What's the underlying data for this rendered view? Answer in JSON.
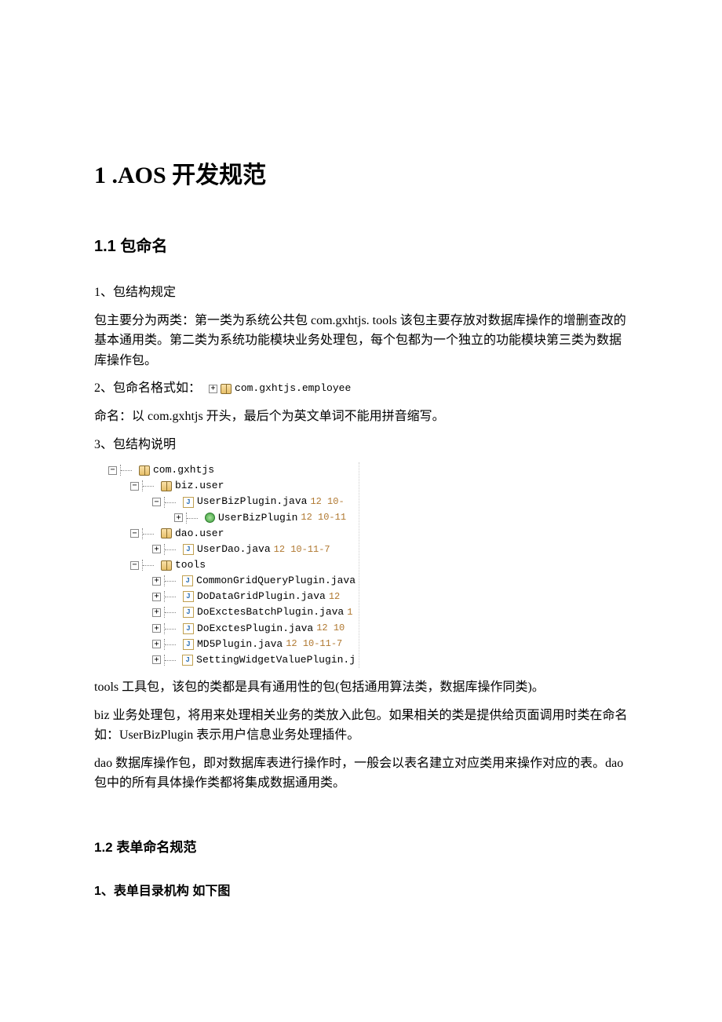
{
  "heading1": "1 .AOS 开发规范",
  "section11": {
    "title": "1.1 包命名",
    "p1": "1、包结构规定",
    "p2": "   包主要分为两类：第一类为系统公共包 com.gxhtjs. tools  该包主要存放对数据库操作的增删查改的基本通用类。第二类为系统功能模块业务处理包，每个包都为一个独立的功能模块第三类为数据库操作包。",
    "p3prefix": "2、包命名格式如：",
    "p3img": "com.gxhtjs.employee",
    "p4": "命名：以 com.gxhtjs 开头，最后个为英文单词不能用拼音缩写。",
    "p5": "3、包结构说明",
    "p6": "tools 工具包，该包的类都是具有通用性的包(包括通用算法类，数据库操作同类)。",
    "p7": "biz   业务处理包，将用来处理相关业务的类放入此包。如果相关的类是提供给页面调用时类在命名如：UserBizPlugin 表示用户信息业务处理插件。",
    "p8": "dao 数据库操作包，即对数据库表进行操作时，一般会以表名建立对应类用来操作对应的表。dao 包中的所有具体操作类都将集成数据通用类。"
  },
  "tree": {
    "root": "com.gxhtjs",
    "n1": "biz.user",
    "n1a": "UserBizPlugin.java",
    "n1a_rev": "12  10-",
    "n1b": "UserBizPlugin",
    "n1b_rev": "12  10-11",
    "n2": "dao.user",
    "n2a": "UserDao.java",
    "n2a_rev": "12  10-11-7",
    "n3": "tools",
    "n3a": "CommonGridQueryPlugin.java",
    "n3b": "DoDataGridPlugin.java",
    "n3b_rev": "12",
    "n3c": "DoExctesBatchPlugin.java",
    "n3c_rev": "1",
    "n3d": "DoExctesPlugin.java",
    "n3d_rev": "12  10",
    "n3e": "MD5Plugin.java",
    "n3e_rev": "12  10-11-7",
    "n3f": "SettingWidgetValuePlugin.j"
  },
  "section12": {
    "title": "1.2 表单命名规范",
    "p1": "1、表单目录机构  如下图"
  }
}
